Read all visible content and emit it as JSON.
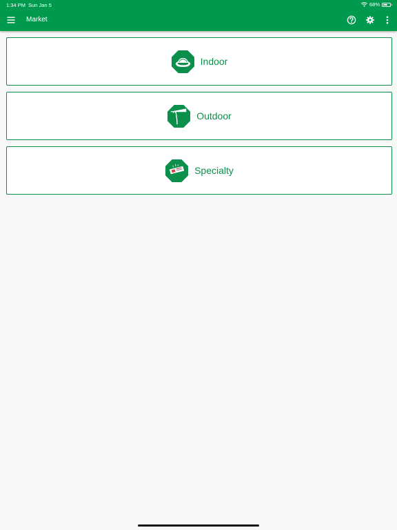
{
  "status_bar": {
    "time": "1:34 PM",
    "date": "Sun Jan 5",
    "battery_percent_label": "68%",
    "battery_level": 0.68
  },
  "app_bar": {
    "title": "Market",
    "icons": [
      "menu-icon",
      "help-icon",
      "gear-icon",
      "more-vert-icon"
    ]
  },
  "categories": [
    {
      "label": "Indoor",
      "icon": "indoor-icon"
    },
    {
      "label": "Outdoor",
      "icon": "outdoor-icon"
    },
    {
      "label": "Specialty",
      "icon": "specialty-icon"
    }
  ],
  "colors": {
    "brand_green": "#009a4e",
    "card_border": "#0b8f4a",
    "background": "#f8f8f8"
  }
}
